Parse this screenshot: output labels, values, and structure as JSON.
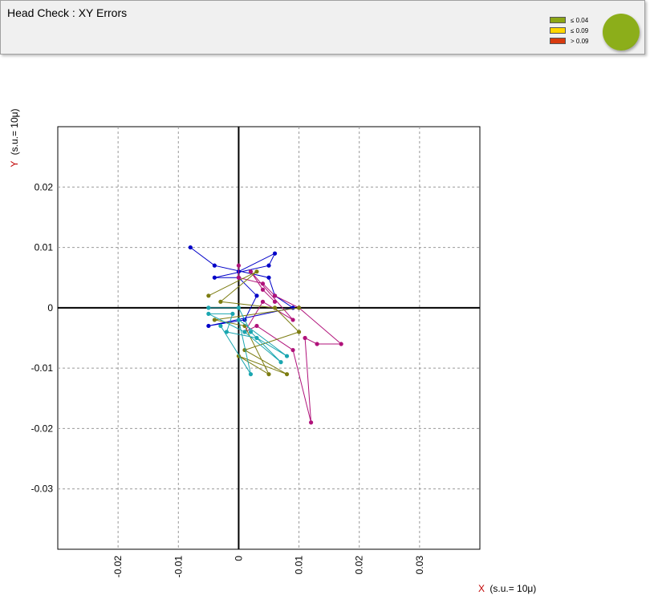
{
  "header": {
    "title": "Head Check : XY Errors"
  },
  "legend": [
    {
      "label": "≤ 0.04",
      "color": "#8ca616"
    },
    {
      "label": "≤ 0.09",
      "color": "#ffd700"
    },
    {
      "label": "> 0.09",
      "color": "#d83a0e"
    }
  ],
  "status_indicator": {
    "color": "#8cae1a",
    "state": "≤ 0.04"
  },
  "chart_data": {
    "type": "line",
    "ylabel": {
      "prefix": "Y",
      "text": "(s.u.= 10μ)"
    },
    "xlabel": {
      "prefix": "X",
      "text": "(s.u.= 10μ)"
    },
    "xlim": [
      -0.03,
      0.04
    ],
    "ylim": [
      -0.04,
      0.03
    ],
    "grid": true,
    "xticks": [
      {
        "v": -0.02,
        "t": "-0.02"
      },
      {
        "v": -0.01,
        "t": "-0.01"
      },
      {
        "v": 0,
        "t": "0"
      },
      {
        "v": 0.01,
        "t": "0.01"
      },
      {
        "v": 0.02,
        "t": "0.02"
      },
      {
        "v": 0.03,
        "t": "0.03"
      }
    ],
    "yticks": [
      {
        "v": 0.02,
        "t": "0.02"
      },
      {
        "v": 0.01,
        "t": "0.01"
      },
      {
        "v": 0,
        "t": "0"
      },
      {
        "v": -0.01,
        "t": "-0.01"
      },
      {
        "v": -0.02,
        "t": "-0.02"
      },
      {
        "v": -0.03,
        "t": "-0.03"
      }
    ],
    "series": [
      {
        "color": "#0000c8",
        "points": [
          [
            -0.008,
            0.01
          ],
          [
            -0.004,
            0.007
          ],
          [
            0.005,
            0.005
          ],
          [
            0.006,
            0.002
          ],
          [
            0.009,
            0.0
          ],
          [
            -0.005,
            -0.003
          ],
          [
            0.001,
            -0.002
          ],
          [
            0.003,
            0.002
          ],
          [
            0.0,
            0.005
          ],
          [
            -0.004,
            0.005
          ],
          [
            0.005,
            0.007
          ],
          [
            0.006,
            0.009
          ],
          [
            0.0,
            0.006
          ]
        ]
      },
      {
        "color": "#b0127a",
        "points": [
          [
            0.0,
            0.007
          ],
          [
            0.0,
            0.005
          ],
          [
            0.004,
            0.004
          ],
          [
            0.006,
            0.002
          ],
          [
            0.01,
            0.0
          ],
          [
            0.017,
            -0.006
          ],
          [
            0.013,
            -0.006
          ],
          [
            0.011,
            -0.005
          ],
          [
            0.012,
            -0.019
          ],
          [
            0.009,
            -0.007
          ],
          [
            0.003,
            -0.003
          ],
          [
            0.001,
            -0.004
          ],
          [
            0.004,
            0.001
          ],
          [
            0.009,
            -0.002
          ],
          [
            0.002,
            0.006
          ],
          [
            0.004,
            0.003
          ],
          [
            0.006,
            0.001
          ]
        ]
      },
      {
        "color": "#7c7c10",
        "points": [
          [
            -0.005,
            0.002
          ],
          [
            0.003,
            0.006
          ],
          [
            -0.003,
            0.001
          ],
          [
            0.006,
            0.0
          ],
          [
            0.01,
            -0.004
          ],
          [
            0.001,
            -0.007
          ],
          [
            0.008,
            -0.011
          ],
          [
            0.0,
            -0.008
          ],
          [
            0.005,
            -0.011
          ],
          [
            0.001,
            -0.003
          ],
          [
            -0.004,
            -0.002
          ],
          [
            0.01,
            0.0
          ]
        ]
      },
      {
        "color": "#1aa6b0",
        "points": [
          [
            -0.005,
            0.0
          ],
          [
            0.0,
            0.0
          ],
          [
            0.002,
            -0.004
          ],
          [
            0.007,
            -0.009
          ],
          [
            0.001,
            -0.004
          ],
          [
            -0.005,
            -0.001
          ],
          [
            -0.001,
            -0.001
          ],
          [
            -0.002,
            -0.004
          ],
          [
            0.003,
            -0.005
          ],
          [
            0.008,
            -0.008
          ],
          [
            0.0,
            -0.002
          ],
          [
            0.002,
            -0.011
          ],
          [
            -0.003,
            -0.003
          ]
        ]
      }
    ]
  }
}
